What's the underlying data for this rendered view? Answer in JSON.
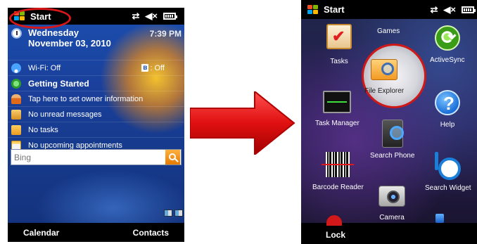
{
  "left_screen": {
    "status": {
      "start_label": "Start"
    },
    "today": {
      "day": "Wednesday",
      "date": "November 03, 2010",
      "time": "7:39 PM",
      "wifi": "Wi-Fi: Off",
      "bluetooth": ": Off",
      "getting_started": "Getting Started",
      "owner_info": "Tap here to set owner information",
      "messages": "No unread messages",
      "tasks": "No tasks",
      "appointments": "No upcoming appointments"
    },
    "search": {
      "placeholder": "Bing"
    },
    "softkeys": {
      "left": "Calendar",
      "right": "Contacts"
    }
  },
  "right_screen": {
    "status": {
      "start_label": "Start"
    },
    "apps": {
      "games": "Games",
      "tasks": "Tasks",
      "activesync": "ActiveSync",
      "file_explorer": "File Explorer",
      "task_manager": "Task Manager",
      "help": "Help",
      "search_phone": "Search Phone",
      "barcode_reader": "Barcode Reader",
      "search_widget": "Search Widget",
      "camera": "Camera"
    },
    "softkeys": {
      "left": "Lock"
    }
  },
  "colors": {
    "highlight_ring": "#d81818",
    "arrow": "#e01010",
    "today_background": "#1a3f9a",
    "start_background": "#2a1f55"
  },
  "icons": {
    "left_status": [
      "windows-logo-icon",
      "sync-icon",
      "volume-mute-icon",
      "battery-icon"
    ],
    "right_status": [
      "windows-logo-icon",
      "sync-icon",
      "volume-mute-icon",
      "battery-icon"
    ]
  }
}
